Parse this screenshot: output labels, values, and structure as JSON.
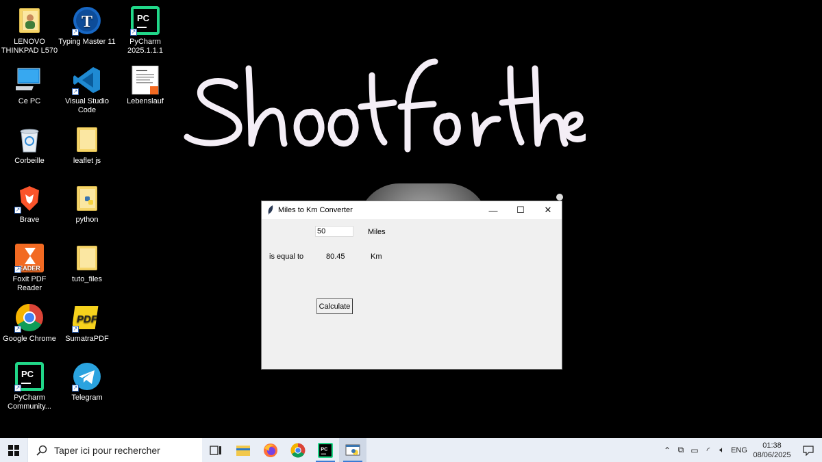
{
  "desktop": {
    "icons": [
      {
        "label": "LENOVO THINKPAD L570",
        "icon": "user-folder-icon"
      },
      {
        "label": "Ce PC",
        "icon": "computer-icon"
      },
      {
        "label": "Corbeille",
        "icon": "recycle-bin-icon"
      },
      {
        "label": "Brave",
        "icon": "brave-icon"
      },
      {
        "label": "Foxit PDF Reader",
        "icon": "foxit-icon"
      },
      {
        "label": "Google Chrome",
        "icon": "chrome-icon"
      },
      {
        "label": "PyCharm Community...",
        "icon": "pycharm-icon"
      },
      {
        "label": "Typing Master 11",
        "icon": "typing-master-icon"
      },
      {
        "label": "Visual Studio Code",
        "icon": "vscode-icon"
      },
      {
        "label": "leaflet js",
        "icon": "folder-icon"
      },
      {
        "label": "python",
        "icon": "folder-icon"
      },
      {
        "label": "tuto_files",
        "icon": "folder-icon"
      },
      {
        "label": "SumatraPDF",
        "icon": "sumatra-icon"
      },
      {
        "label": "Telegram",
        "icon": "telegram-icon"
      },
      {
        "label": "PyCharm 2025.1.1.1",
        "icon": "pycharm-icon"
      },
      {
        "label": "Lebenslauf",
        "icon": "document-icon"
      }
    ],
    "wallpaper_text": "Shoot for the"
  },
  "window": {
    "title": "Miles to Km Converter",
    "miles_input_value": "50",
    "miles_label": "Miles",
    "equal_label": "is equal to",
    "result_value": "80.45",
    "km_label": "Km",
    "calculate_label": "Calculate",
    "minimize_glyph": "—",
    "maximize_glyph": "☐",
    "close_glyph": "✕"
  },
  "taskbar": {
    "search_placeholder": "Taper ici pour rechercher",
    "language": "ENG",
    "time": "01:38",
    "date": "08/06/2025",
    "accent": "#3a7bd5"
  }
}
